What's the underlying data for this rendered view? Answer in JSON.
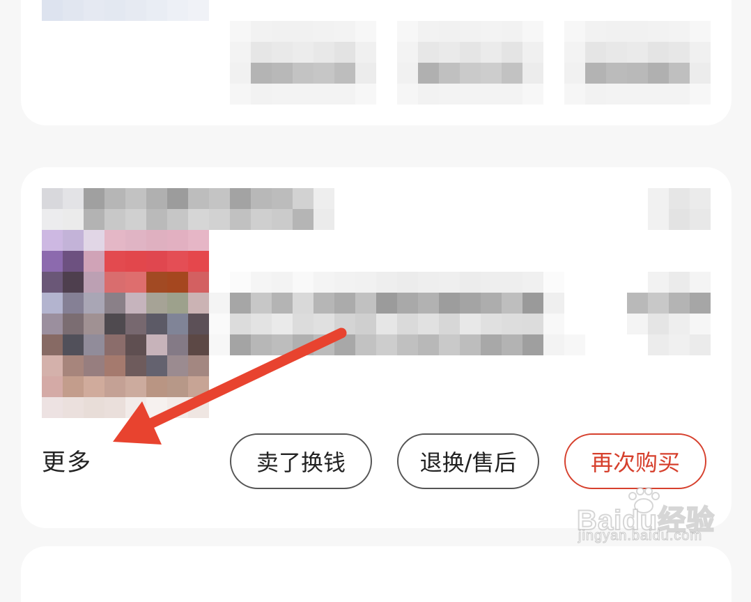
{
  "order_card": {
    "more_label": "更多",
    "actions": {
      "sell_label": "卖了换钱",
      "return_label": "退换/售后",
      "rebuy_label": "再次购买"
    }
  },
  "colors": {
    "accent": "#d6402d",
    "annotation_arrow": "#e8432f"
  },
  "watermark": {
    "brand": "Baidu经验",
    "url": "jingyan.baidu.com"
  }
}
